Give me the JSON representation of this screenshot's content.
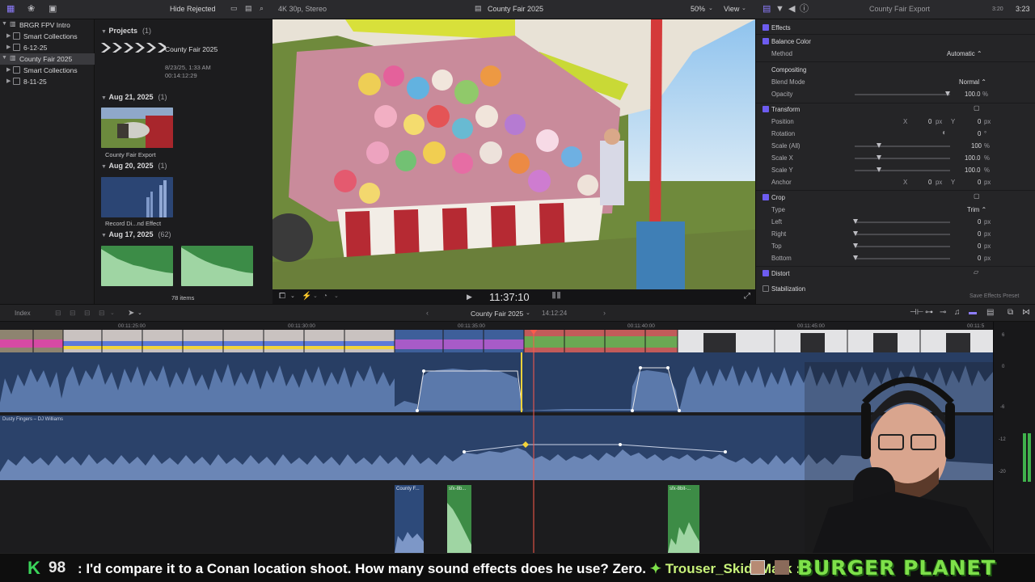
{
  "toolbar": {
    "filter": "Hide Rejected",
    "format": "4K 30p, Stereo",
    "project_title": "County Fair 2025",
    "zoom": "50%",
    "view": "View",
    "inspector_title": "County Fair Export",
    "duration": "3:23"
  },
  "libraries": {
    "items": [
      {
        "label": "BRGR FPV Intro"
      },
      {
        "label": "Smart Collections"
      },
      {
        "label": "6-12-25"
      },
      {
        "label": "County Fair 2025"
      },
      {
        "label": "Smart Collections"
      },
      {
        "label": "8-11-25"
      }
    ]
  },
  "browser": {
    "projects_header": "Projects",
    "projects_count": "(1)",
    "project_name": "County Fair 2025",
    "project_date": "8/23/25, 1:33 AM",
    "project_duration": "00:14:12:29",
    "groups": [
      {
        "date": "Aug 21, 2025",
        "count": "(1)",
        "clip": "County Fair Export"
      },
      {
        "date": "Aug 20, 2025",
        "count": "(1)",
        "clip": "Record Di...nd Effect"
      },
      {
        "date": "Aug 17, 2025",
        "count": "(62)"
      }
    ],
    "item_count": "78 items"
  },
  "viewer": {
    "timecode": "11:37:10"
  },
  "inspector": {
    "effects": "Effects",
    "balance_color": "Balance Color",
    "method_label": "Method",
    "method_value": "Automatic ⌃",
    "compositing": "Compositing",
    "blend_mode_label": "Blend Mode",
    "blend_mode_value": "Normal ⌃",
    "opacity_label": "Opacity",
    "opacity_value": "100.0",
    "transform": "Transform",
    "position_label": "Position",
    "rotation_label": "Rotation",
    "scale_all_label": "Scale (All)",
    "scale_x_label": "Scale X",
    "scale_y_label": "Scale Y",
    "anchor_label": "Anchor",
    "crop": "Crop",
    "type_label": "Type",
    "type_value": "Trim ⌃",
    "left_label": "Left",
    "right_label": "Right",
    "top_label": "Top",
    "bottom_label": "Bottom",
    "distort": "Distort",
    "stabilization": "Stabilization",
    "save_preset": "Save Effects Preset",
    "unit_px": "px",
    "unit_pct": "%",
    "unit_deg": "°",
    "x_label": "X",
    "y_label": "Y",
    "zero": "0",
    "hundred_int": "100",
    "hundred": "100.0"
  },
  "timeline": {
    "index": "Index",
    "project": "County Fair 2025",
    "duration": "14:12:24",
    "ruler_ticks": [
      "00:11:25:00",
      "00:11:30:00",
      "00:11:35:00",
      "00:11:40:00",
      "00:11:45:00",
      "00:11:5"
    ],
    "music_track": "Dusty Fingers – DJ Williams",
    "sfx_clips": [
      "County F...",
      "sfx-8b...",
      "sfx-8bit-..."
    ],
    "meter_labels": [
      "6",
      "0",
      "-6",
      "-12",
      "-20"
    ]
  },
  "ticker": {
    "prefix": "K",
    "count": "98",
    "message": ": I'd compare it to a Conan location shoot. How many sound effects does he use? Zero.",
    "user": "Trouser_Skid_Mark :",
    "brand": "BURGER PLANET"
  },
  "colors": {
    "accent": "#6d5cf0",
    "audio_wave": "#5f7aa8",
    "clip_green": "#3f9b4a",
    "playhead": "#ff5a4a",
    "brand_green": "#7ee04a"
  }
}
